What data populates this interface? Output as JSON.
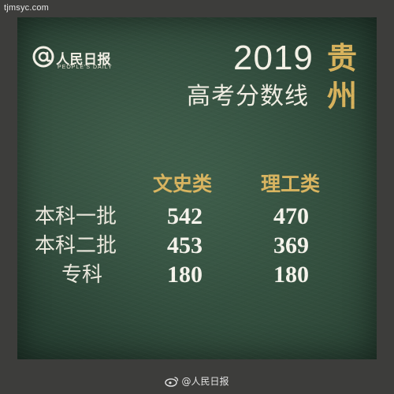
{
  "watermark_top": "tjmsyc.com",
  "logo": {
    "name": "人民日报",
    "english": "PEOPLE'S DAILY"
  },
  "title": {
    "year": "2019",
    "province_char_1": "贵",
    "province_char_2": "州",
    "subtitle": "高考分数线"
  },
  "table": {
    "columns": [
      "文史类",
      "理工类"
    ],
    "rows": [
      {
        "label": "本科一批",
        "values": [
          "542",
          "470"
        ]
      },
      {
        "label": "本科二批",
        "values": [
          "453",
          "369"
        ]
      },
      {
        "label": "专科",
        "values": [
          "180",
          "180"
        ]
      }
    ]
  },
  "watermark_bottom": "@人民日报",
  "colors": {
    "gold": "#d7b25c",
    "chalk": "#f4f1e6",
    "board": "#2c4537",
    "frame": "#3d3d3b"
  },
  "icons": {
    "logo": "at-sign-icon",
    "bottom": "weibo-icon"
  }
}
